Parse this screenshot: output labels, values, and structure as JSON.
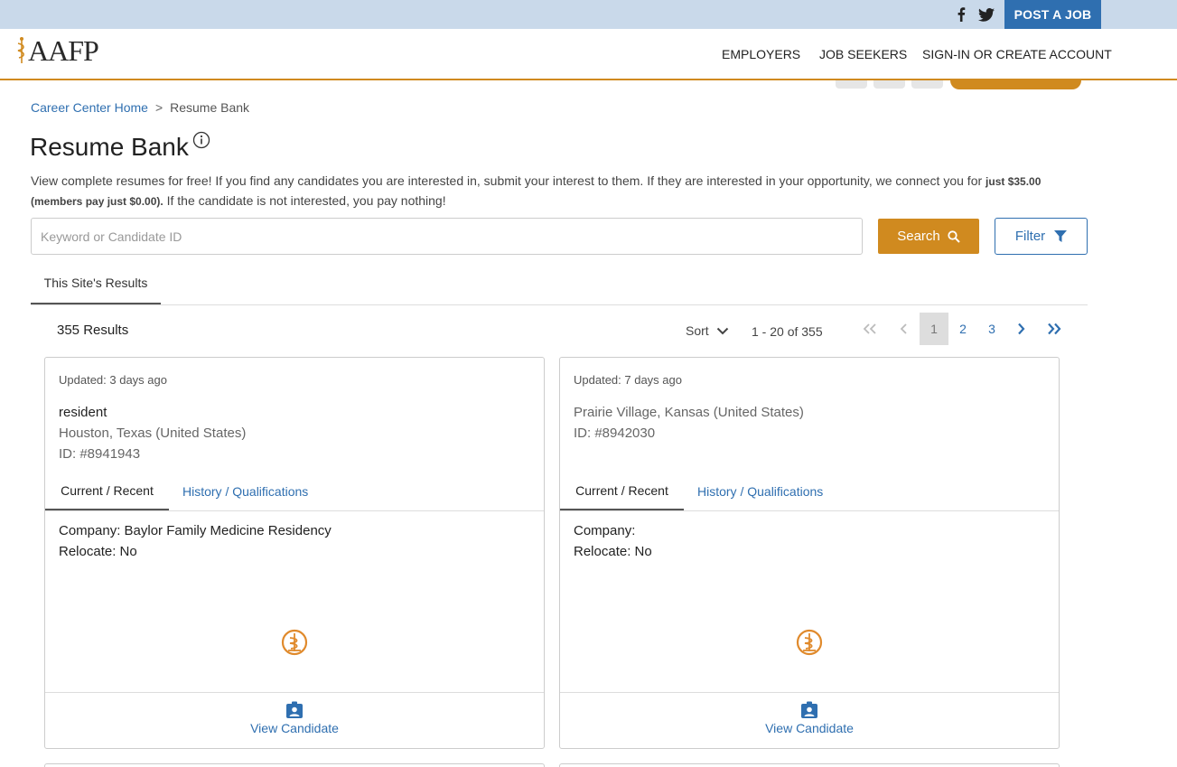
{
  "topbar": {
    "facebook_icon": "facebook-icon",
    "twitter_icon": "twitter-icon",
    "post_job_label": "POST A JOB"
  },
  "header": {
    "logo_text": "AAFP",
    "nav": {
      "employers": "EMPLOYERS",
      "job_seekers": "JOB SEEKERS",
      "sign_in": "SIGN-IN OR CREATE ACCOUNT"
    }
  },
  "breadcrumb": {
    "home": "Career Center Home",
    "separator": ">",
    "current": "Resume Bank"
  },
  "page": {
    "title": "Resume Bank",
    "desc_part1": "View complete resumes for free! If you find any candidates you are interested in, submit your interest to them. If they are interested in your opportunity, we connect you for ",
    "desc_bold": "just $35.00 (members pay just $0.00).",
    "desc_part2": " If the candidate is not interested, you pay nothing!"
  },
  "search": {
    "placeholder": "Keyword or Candidate ID",
    "value": "",
    "search_label": "Search",
    "filter_label": "Filter"
  },
  "tabs": {
    "site_results": "This Site's Results"
  },
  "results": {
    "count_text": "355 Results",
    "sort_label": "Sort",
    "range_text": "1 - 20 of 355",
    "pages": [
      "1",
      "2",
      "3"
    ],
    "current_page": "1"
  },
  "cards": [
    {
      "updated": "Updated: 3 days ago",
      "line1": "resident",
      "line2": "Houston, Texas (United States)",
      "line3": "ID: #8941943",
      "tab_current": "Current / Recent",
      "tab_history": "History / Qualifications",
      "company": "Company: Baylor Family Medicine Residency",
      "relocate": "Relocate: No",
      "view_label": "View Candidate"
    },
    {
      "updated": "Updated: 7 days ago",
      "line1": "Prairie Village, Kansas (United States)",
      "line2": "ID: #8942030",
      "line3": "",
      "tab_current": "Current / Recent",
      "tab_history": "History / Qualifications",
      "company": "Company:",
      "relocate": "Relocate: No",
      "view_label": "View Candidate"
    }
  ],
  "colors": {
    "brand_orange": "#d08a1f",
    "brand_blue": "#2f6fb0",
    "topbar_bg": "#c9d9ea"
  }
}
